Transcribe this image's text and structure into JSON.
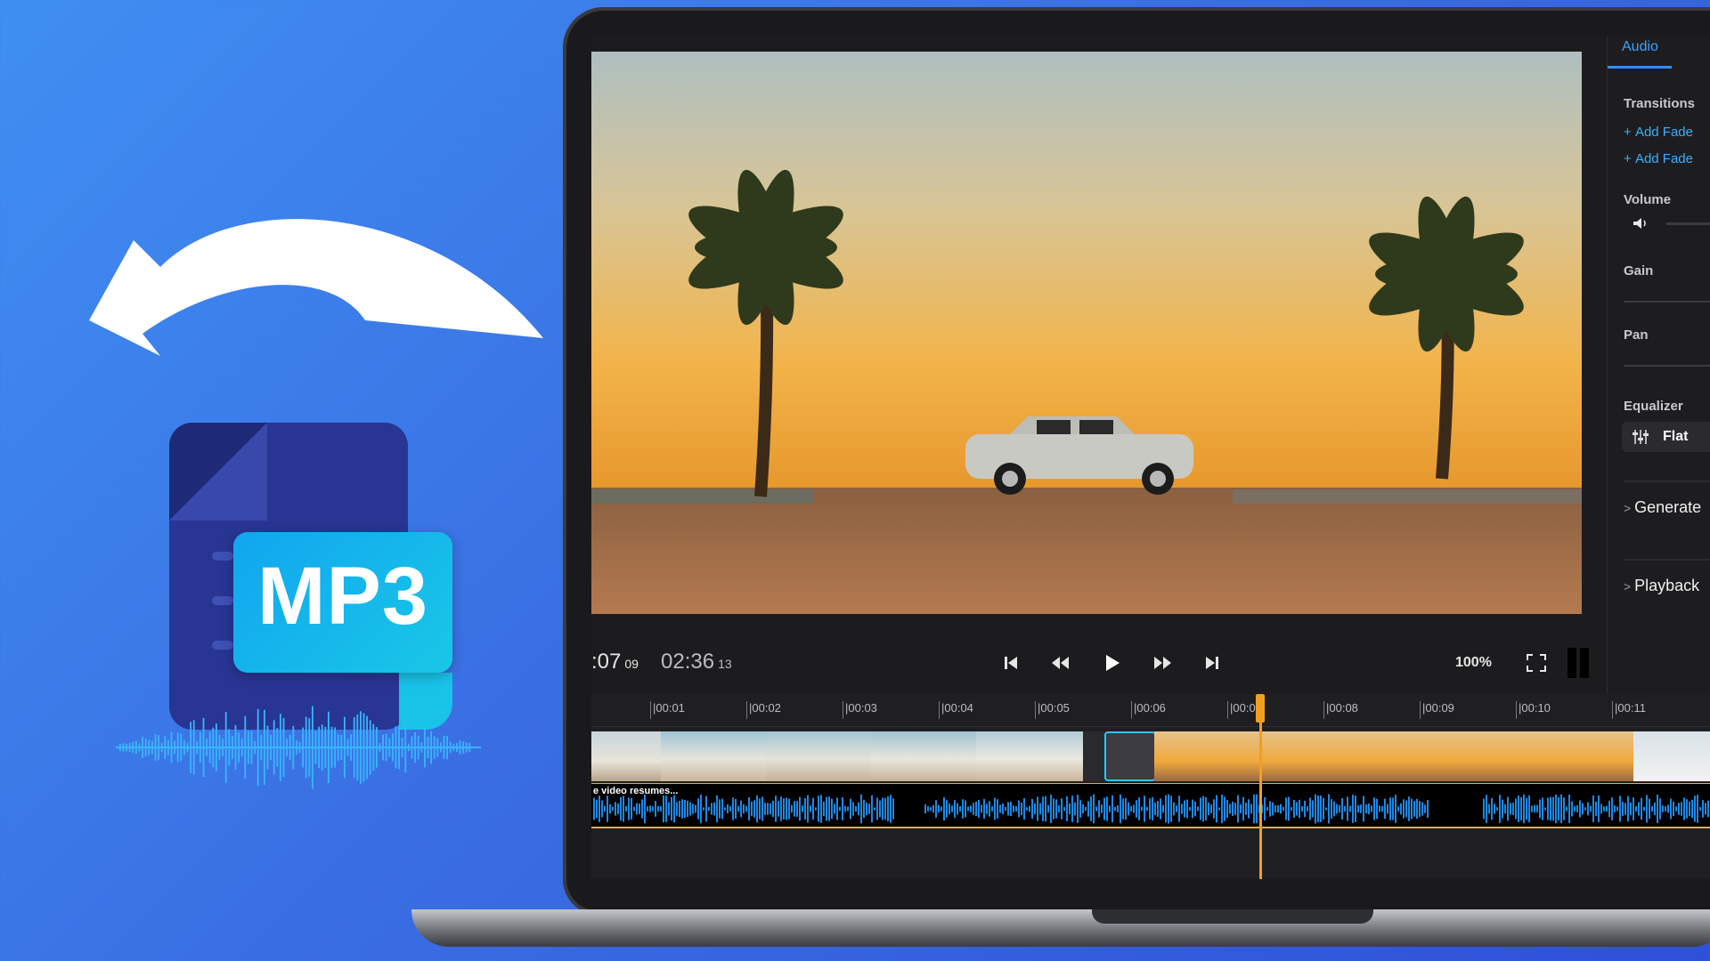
{
  "badge": {
    "format_label": "MP3"
  },
  "player": {
    "current_time": ":07",
    "current_frame": "09",
    "total_time": "02:36",
    "total_frame": "13",
    "zoom": "100%"
  },
  "panel": {
    "tab_label": "Audio",
    "transitions_title": "Transitions",
    "add_fade_in": "Add Fade",
    "add_fade_out": "Add Fade",
    "volume_title": "Volume",
    "gain_title": "Gain",
    "pan_title": "Pan",
    "equalizer_title": "Equalizer",
    "equalizer_value": "Flat",
    "generate_label": "Generate",
    "playback_label": "Playback"
  },
  "timeline": {
    "ticks": [
      "|00:01",
      "|00:02",
      "|00:03",
      "|00:04",
      "|00:05",
      "|00:06",
      "|00:0",
      "|00:08",
      "|00:09",
      "|00:10",
      "|00:11"
    ],
    "audio_clip_label": "e video resumes..."
  },
  "colors": {
    "accent": "#2f8eff",
    "playhead": "#f0a020",
    "waveform": "#1e88e5",
    "mp3_badge": "#11a6f0"
  }
}
